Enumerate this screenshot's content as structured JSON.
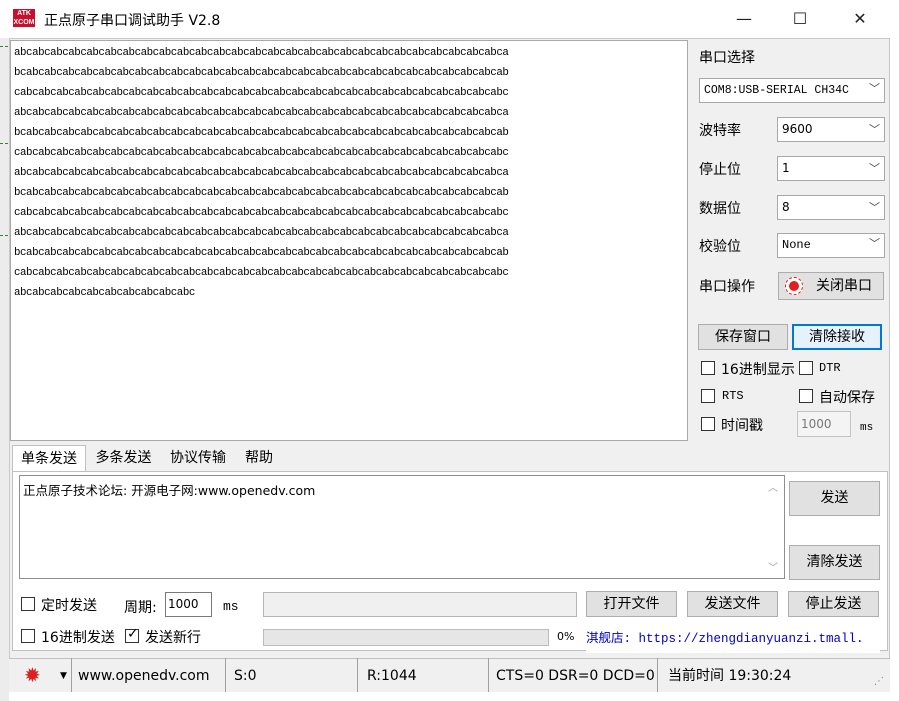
{
  "window": {
    "title": "正点原子串口调试助手 V2.8",
    "icon_text_top": "ATK",
    "icon_text_bottom": "XCOM",
    "minimize": "—",
    "maximize": "☐",
    "close": "✕"
  },
  "receive": {
    "lines": [
      "abcabcabcabcabcabcabcabcabcabcabcabcabcabcabcabcabcabcabcabcabcabcabcabcabcabcabca",
      "bcabcabcabcabcabcabcabcabcabcabcabcabcabcabcabcabcabcabcabcabcabcabcabcabcabcabcab",
      "cabcabcabcabcabcabcabcabcabcabcabcabcabcabcabcabcabcabcabcabcabcabcabcabcabcabcabc",
      "abcabcabcabcabcabcabcabcabcabcabcabcabcabcabcabcabcabcabcabcabcabcabcabcabcabcabca",
      "bcabcabcabcabcabcabcabcabcabcabcabcabcabcabcabcabcabcabcabcabcabcabcabcabcabcabcab",
      "cabcabcabcabcabcabcabcabcabcabcabcabcabcabcabcabcabcabcabcabcabcabcabcabcabcabcabc",
      "abcabcabcabcabcabcabcabcabcabcabcabcabcabcabcabcabcabcabcabcabcabcabcabcabcabcabca",
      "bcabcabcabcabcabcabcabcabcabcabcabcabcabcabcabcabcabcabcabcabcabcabcabcabcabcabcab",
      "cabcabcabcabcabcabcabcabcabcabcabcabcabcabcabcabcabcabcabcabcabcabcabcabcabcabcabc",
      "abcabcabcabcabcabcabcabcabcabcabcabcabcabcabcabcabcabcabcabcabcabcabcabcabcabcabca",
      "bcabcabcabcabcabcabcabcabcabcabcabcabcabcabcabcabcabcabcabcabcabcabcabcabcabcabcab",
      "cabcabcabcabcabcabcabcabcabcabcabcabcabcabcabcabcabcabcabcabcabcabcabcabcabcabcabc",
      "abcabcabcabcabcabcabcabcabcabc"
    ]
  },
  "settings": {
    "port_label": "串口选择",
    "port_value": "COM8:USB-SERIAL CH34C",
    "baud_label": "波特率",
    "baud_value": "9600",
    "stop_label": "停止位",
    "stop_value": "1",
    "data_label": "数据位",
    "data_value": "8",
    "parity_label": "校验位",
    "parity_value": "None",
    "op_label": "串口操作",
    "op_button": "关闭串口"
  },
  "actions": {
    "save_window": "保存窗口",
    "clear_receive": "清除接收",
    "hex_display": "16进制显示",
    "dtr": "DTR",
    "rts": "RTS",
    "auto_save": "自动保存",
    "timestamp": "时间戳",
    "timestamp_value": "1000",
    "timestamp_unit": "ms"
  },
  "tabs": [
    "单条发送",
    "多条发送",
    "协议传输",
    "帮助"
  ],
  "send": {
    "text": "正点原子技术论坛: 开源电子网:www.openedv.com",
    "send_button": "发送",
    "clear_send_button": "清除发送",
    "timed_send": "定时发送",
    "period_label": "周期:",
    "period_value": "1000",
    "period_unit": "ms",
    "open_file": "打开文件",
    "send_file": "发送文件",
    "stop_send": "停止发送",
    "hex_send": "16进制发送",
    "send_newline": "发送新行",
    "progress_text": "0%",
    "progress_value": 0,
    "shop_text": "淇舰店: https://zhengdianyuanzi.tmall."
  },
  "status": {
    "url": "www.openedv.com",
    "sent": "S:0",
    "received": "R:1044",
    "lines": "CTS=0 DSR=0 DCD=0",
    "time": "当前时间 19:30:24"
  },
  "colors": {
    "accent": "#0078d7",
    "record_red": "#e02020",
    "link_blue": "#0000cc"
  }
}
